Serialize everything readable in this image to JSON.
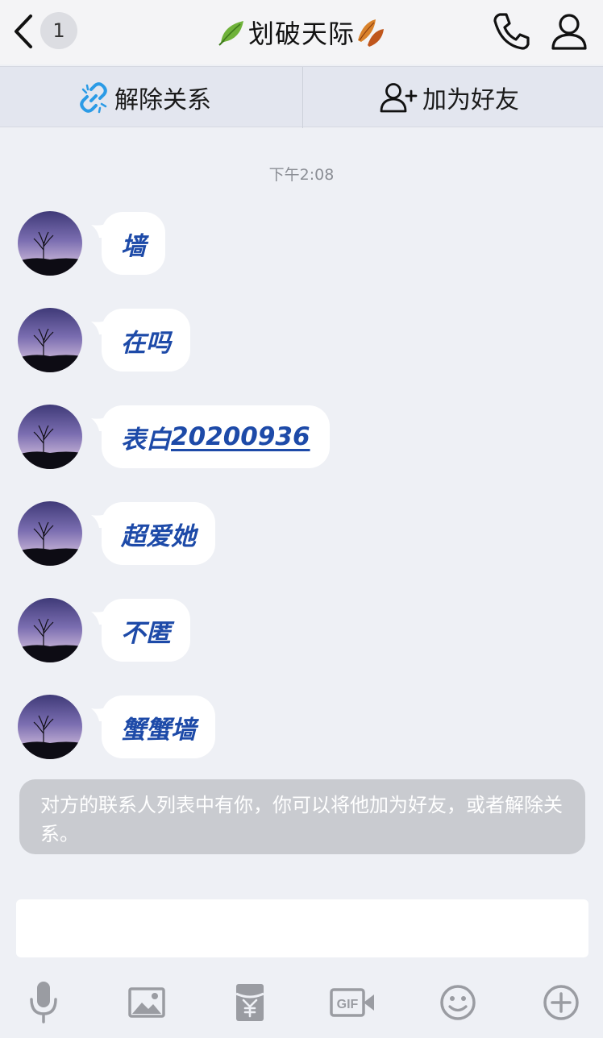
{
  "nav": {
    "badge_count": "1",
    "title": "划破天际"
  },
  "actions": {
    "unlink_label": "解除关系",
    "add_friend_label": "加为好友"
  },
  "chat": {
    "timestamp": "下午2:08",
    "messages": [
      {
        "text": "墙"
      },
      {
        "text": "在吗"
      },
      {
        "prefix": "表白",
        "number": "20200936"
      },
      {
        "text": "超爱她"
      },
      {
        "text": "不匿"
      },
      {
        "text": "蟹蟹墙"
      }
    ],
    "notice": "对方的联系人列表中有你，你可以将他加为好友，或者解除关系。"
  },
  "input": {
    "placeholder": ""
  },
  "toolbar": {
    "icons": [
      "microphone-icon",
      "image-icon",
      "red-packet-icon",
      "gif-icon",
      "emoji-icon",
      "plus-icon"
    ]
  },
  "colors": {
    "bubble_text": "#1d4aa8",
    "accent_blue": "#2b9be6",
    "background": "#eef0f5"
  }
}
